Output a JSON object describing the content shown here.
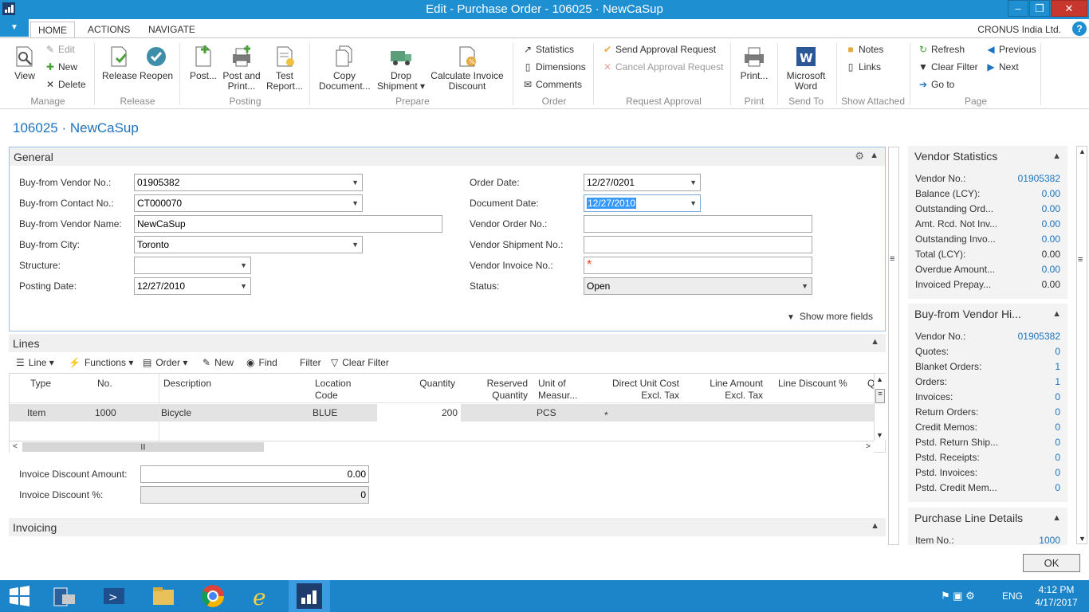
{
  "window": {
    "title": "Edit - Purchase Order - 106025 · NewCaSup"
  },
  "ribbon_tabs": [
    "HOME",
    "ACTIONS",
    "NAVIGATE"
  ],
  "company": "CRONUS India Ltd.",
  "ribbon": {
    "manage": {
      "group": "Manage",
      "view": "View",
      "edit": "Edit",
      "new": "New",
      "delete": "Delete"
    },
    "release": {
      "group": "Release",
      "release": "Release",
      "reopen": "Reopen"
    },
    "posting": {
      "group": "Posting",
      "post": "Post...",
      "post_print_1": "Post and",
      "post_print_2": "Print...",
      "test_1": "Test",
      "test_2": "Report..."
    },
    "prepare": {
      "group": "Prepare",
      "copy_1": "Copy",
      "copy_2": "Document...",
      "drop_1": "Drop",
      "drop_2": "Shipment ▾",
      "calc_1": "Calculate Invoice",
      "calc_2": "Discount"
    },
    "order": {
      "group": "Order",
      "statistics": "Statistics",
      "dimensions": "Dimensions",
      "comments": "Comments"
    },
    "approval": {
      "group": "Request Approval",
      "send": "Send Approval Request",
      "cancel": "Cancel Approval Request"
    },
    "print": {
      "group": "Print",
      "print": "Print..."
    },
    "sendto": {
      "group": "Send To",
      "word_1": "Microsoft",
      "word_2": "Word"
    },
    "attached": {
      "group": "Show Attached",
      "notes": "Notes",
      "links": "Links"
    },
    "page": {
      "group": "Page",
      "refresh": "Refresh",
      "clear_filter": "Clear Filter",
      "goto": "Go to",
      "previous": "Previous",
      "next": "Next"
    }
  },
  "page_title": "106025 · NewCaSup",
  "general": {
    "header": "General",
    "buy_from_vendor_no": {
      "label": "Buy-from Vendor No.:",
      "value": "01905382"
    },
    "buy_from_contact_no": {
      "label": "Buy-from Contact No.:",
      "value": "CT000070"
    },
    "buy_from_vendor_name": {
      "label": "Buy-from Vendor Name:",
      "value": "NewCaSup"
    },
    "buy_from_city": {
      "label": "Buy-from City:",
      "value": "Toronto"
    },
    "structure": {
      "label": "Structure:",
      "value": ""
    },
    "posting_date": {
      "label": "Posting Date:",
      "value": "12/27/2010"
    },
    "order_date": {
      "label": "Order Date:",
      "value": "12/27/0201"
    },
    "document_date": {
      "label": "Document Date:",
      "value": "12/27/2010"
    },
    "vendor_order_no": {
      "label": "Vendor Order No.:",
      "value": ""
    },
    "vendor_shipment_no": {
      "label": "Vendor Shipment No.:",
      "value": ""
    },
    "vendor_invoice_no": {
      "label": "Vendor Invoice No.:",
      "value": ""
    },
    "status": {
      "label": "Status:",
      "value": "Open"
    },
    "show_more": "Show more fields"
  },
  "lines": {
    "header": "Lines",
    "toolbar": {
      "line": "Line ▾",
      "functions": "Functions ▾",
      "order": "Order ▾",
      "new": "New",
      "find": "Find",
      "filter": "Filter",
      "clear_filter": "Clear Filter"
    },
    "columns": {
      "type": "Type",
      "no": "No.",
      "description": "Description",
      "loc_1": "Location",
      "loc_2": "Code",
      "quantity": "Quantity",
      "res_1": "Reserved",
      "res_2": "Quantity",
      "uom_1": "Unit of",
      "uom_2": "Measur...",
      "duc_1": "Direct Unit Cost",
      "duc_2": "Excl. Tax",
      "la_1": "Line Amount",
      "la_2": "Excl. Tax",
      "ld": "Line Discount %",
      "q": "Q"
    },
    "row": {
      "type": "Item",
      "no": "1000",
      "description": "Bicycle",
      "location": "BLUE",
      "quantity": "200",
      "uom": "PCS"
    }
  },
  "invoice_discount_amount": {
    "label": "Invoice Discount Amount:",
    "value": "0.00"
  },
  "invoice_discount_pct": {
    "label": "Invoice Discount %:",
    "value": "0"
  },
  "invoicing": {
    "header": "Invoicing"
  },
  "vendor_statistics": {
    "header": "Vendor Statistics",
    "rows": [
      {
        "label": "Vendor No.:",
        "value": "01905382"
      },
      {
        "label": "Balance (LCY):",
        "value": "0.00"
      },
      {
        "label": "Outstanding Ord...",
        "value": "0.00"
      },
      {
        "label": "Amt. Rcd. Not Inv...",
        "value": "0.00"
      },
      {
        "label": "Outstanding Invo...",
        "value": "0.00"
      },
      {
        "label": "Total (LCY):",
        "value": "0.00"
      },
      {
        "label": "Overdue Amount...",
        "value": "0.00"
      },
      {
        "label": "Invoiced Prepay...",
        "value": "0.00"
      }
    ]
  },
  "vendor_history": {
    "header": "Buy-from Vendor Hi...",
    "rows": [
      {
        "label": "Vendor No.:",
        "value": "01905382"
      },
      {
        "label": "Quotes:",
        "value": "0"
      },
      {
        "label": "Blanket Orders:",
        "value": "1"
      },
      {
        "label": "Orders:",
        "value": "1"
      },
      {
        "label": "Invoices:",
        "value": "0"
      },
      {
        "label": "Return Orders:",
        "value": "0"
      },
      {
        "label": "Credit Memos:",
        "value": "0"
      },
      {
        "label": "Pstd. Return Ship...",
        "value": "0"
      },
      {
        "label": "Pstd. Receipts:",
        "value": "0"
      },
      {
        "label": "Pstd. Invoices:",
        "value": "0"
      },
      {
        "label": "Pstd. Credit Mem...",
        "value": "0"
      }
    ]
  },
  "purchase_line_details": {
    "header": "Purchase Line Details",
    "item_no_label": "Item No.:",
    "item_no_value": "1000"
  },
  "ok_button": "OK",
  "taskbar": {
    "lang": "ENG",
    "time": "4:12 PM",
    "date": "4/17/2017"
  },
  "colors": {
    "accent": "#1e8fd1",
    "link": "#1e73be",
    "required": "#e8411b",
    "taskbar": "#1c84c9"
  }
}
